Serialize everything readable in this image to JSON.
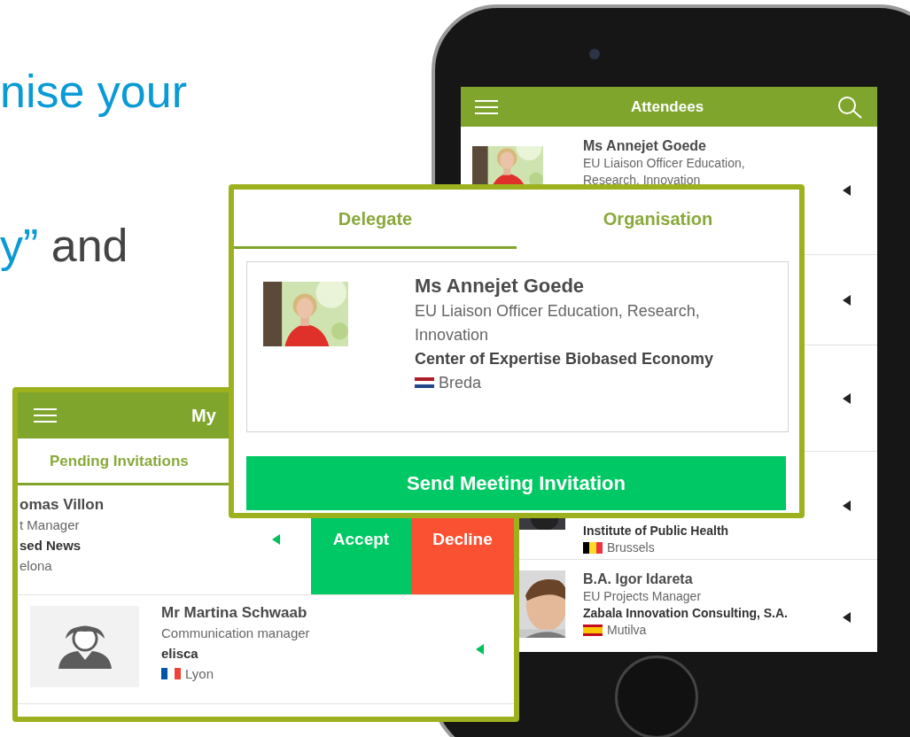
{
  "headline": [
    {
      "segments": [
        {
          "text": "nise your",
          "kind": "accent"
        }
      ]
    },
    {
      "segments": [
        {
          "text": "y”",
          "kind": "accent"
        },
        {
          "text": " and",
          "kind": "plain"
        }
      ]
    }
  ],
  "phone": {
    "title": "Attendees",
    "attendees": [
      {
        "kind": "full",
        "name": "Ms Annejet Goede",
        "title": "EU Liaison Officer Education, Research, Innovation"
      },
      {
        "kind": "hidden"
      },
      {
        "kind": "hidden"
      },
      {
        "kind": "partial",
        "organisation": "Institute of Public Health",
        "city": "Brussels"
      },
      {
        "kind": "full",
        "name": "B.A. Igor Idareta",
        "title": "EU Projects Manager",
        "organisation": "Zabala Innovation Consulting, S.A.",
        "city": "Mutilva"
      }
    ]
  },
  "invitations_screen": {
    "title": "My",
    "tabs": [
      {
        "label": "Pending Invitations",
        "selected": true
      }
    ],
    "invitations": [
      {
        "swiped": true,
        "name": "omas Villon",
        "title": "t Manager",
        "organisation": "sed News",
        "city": "elona",
        "actions": [
          {
            "label": "Accept",
            "kind": "accept"
          },
          {
            "label": "Decline",
            "kind": "decline"
          }
        ]
      },
      {
        "swiped": false,
        "name": "Mr Martina Schwaab",
        "title": "Communication manager",
        "organisation": "elisca",
        "city": "Lyon"
      }
    ]
  },
  "dialog": {
    "tabs": [
      {
        "label": "Delegate",
        "selected": true
      },
      {
        "label": "Organisation",
        "selected": false
      }
    ],
    "delegate": {
      "name": "Ms Annejet Goede",
      "title": "EU Liaison Officer Education, Research, Innovation",
      "organisation": "Center of Expertise Biobased Economy",
      "city": "Breda"
    },
    "button": "Send Meeting Invitation"
  }
}
